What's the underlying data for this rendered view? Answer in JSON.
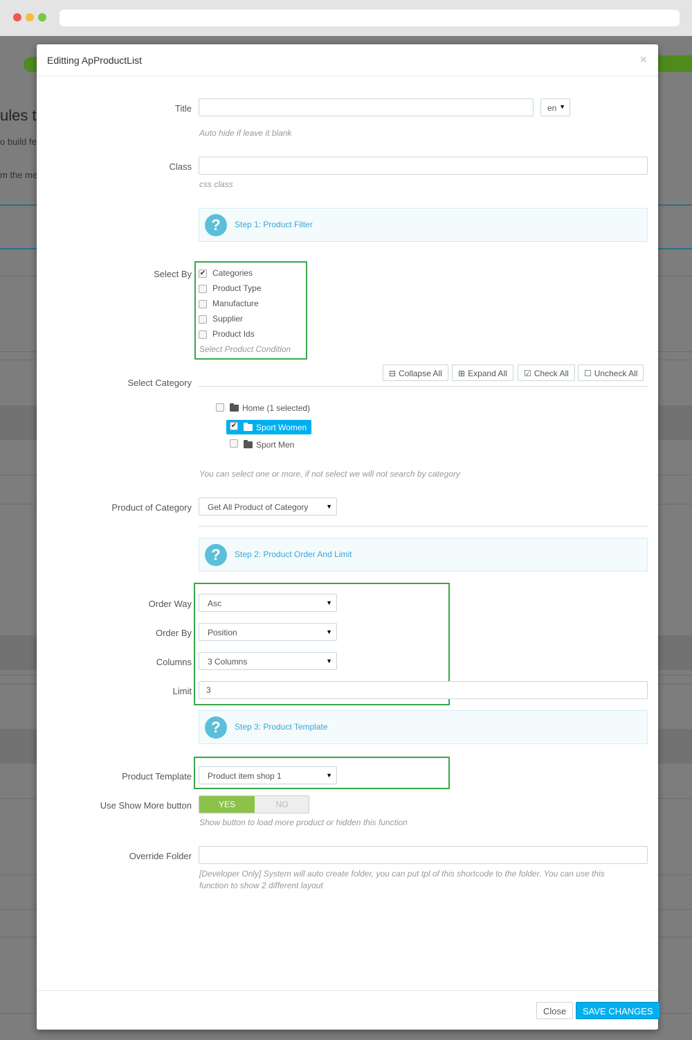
{
  "background": {
    "heading": "ules to",
    "line1": "o build fe",
    "line2": "m the me"
  },
  "modal": {
    "title": "Editting ApProductList",
    "close_icon": "×",
    "title_field": {
      "label": "Title",
      "value": "",
      "lang": "en",
      "help": "Auto hide if leave it blank"
    },
    "class_field": {
      "label": "Class",
      "value": "",
      "help": "css class"
    },
    "step1": "Step 1: Product Filter",
    "select_by": {
      "label": "Select By",
      "options": [
        {
          "label": "Categories",
          "checked": true
        },
        {
          "label": "Product Type",
          "checked": false
        },
        {
          "label": "Manufacture",
          "checked": false
        },
        {
          "label": "Supplier",
          "checked": false
        },
        {
          "label": "Product Ids",
          "checked": false
        }
      ],
      "help": "Select Product Condition"
    },
    "select_category": {
      "label": "Select Category",
      "buttons": {
        "collapse": "Collapse All",
        "expand": "Expand All",
        "check": "Check All",
        "uncheck": "Uncheck All"
      },
      "tree": {
        "root": "Home (1 selected)",
        "children": [
          {
            "label": "Sport Women",
            "checked": true,
            "selected": true
          },
          {
            "label": "Sport Men",
            "checked": false,
            "selected": false
          }
        ]
      },
      "help": "You can select one or more, if not select we will not search by category"
    },
    "product_of_category": {
      "label": "Product of Category",
      "value": "Get All Product of Category"
    },
    "step2": "Step 2: Product Order And Limit",
    "order_way": {
      "label": "Order Way",
      "value": "Asc"
    },
    "order_by": {
      "label": "Order By",
      "value": "Position"
    },
    "columns": {
      "label": "Columns",
      "value": "3 Columns"
    },
    "limit": {
      "label": "Limit",
      "value": "3"
    },
    "step3": "Step 3: Product Template",
    "product_template": {
      "label": "Product Template",
      "value": "Product item shop 1"
    },
    "show_more": {
      "label": "Use Show More button",
      "yes": "YES",
      "no": "NO",
      "help": "Show button to load more product or hidden this function"
    },
    "override_folder": {
      "label": "Override Folder",
      "value": "",
      "help_line1": "[Developer Only] System will auto create folder, you can put tpl of this shortcode to the folder. You can use this",
      "help_line2": "function to show 2 different layout"
    },
    "footer": {
      "close": "Close",
      "save": "SAVE CHANGES"
    }
  },
  "colors": {
    "accent": "#3aa5d1",
    "toggle_on": "#8bc34a",
    "save_button": "#00aff0",
    "highlight_box": "#3aa64a"
  }
}
